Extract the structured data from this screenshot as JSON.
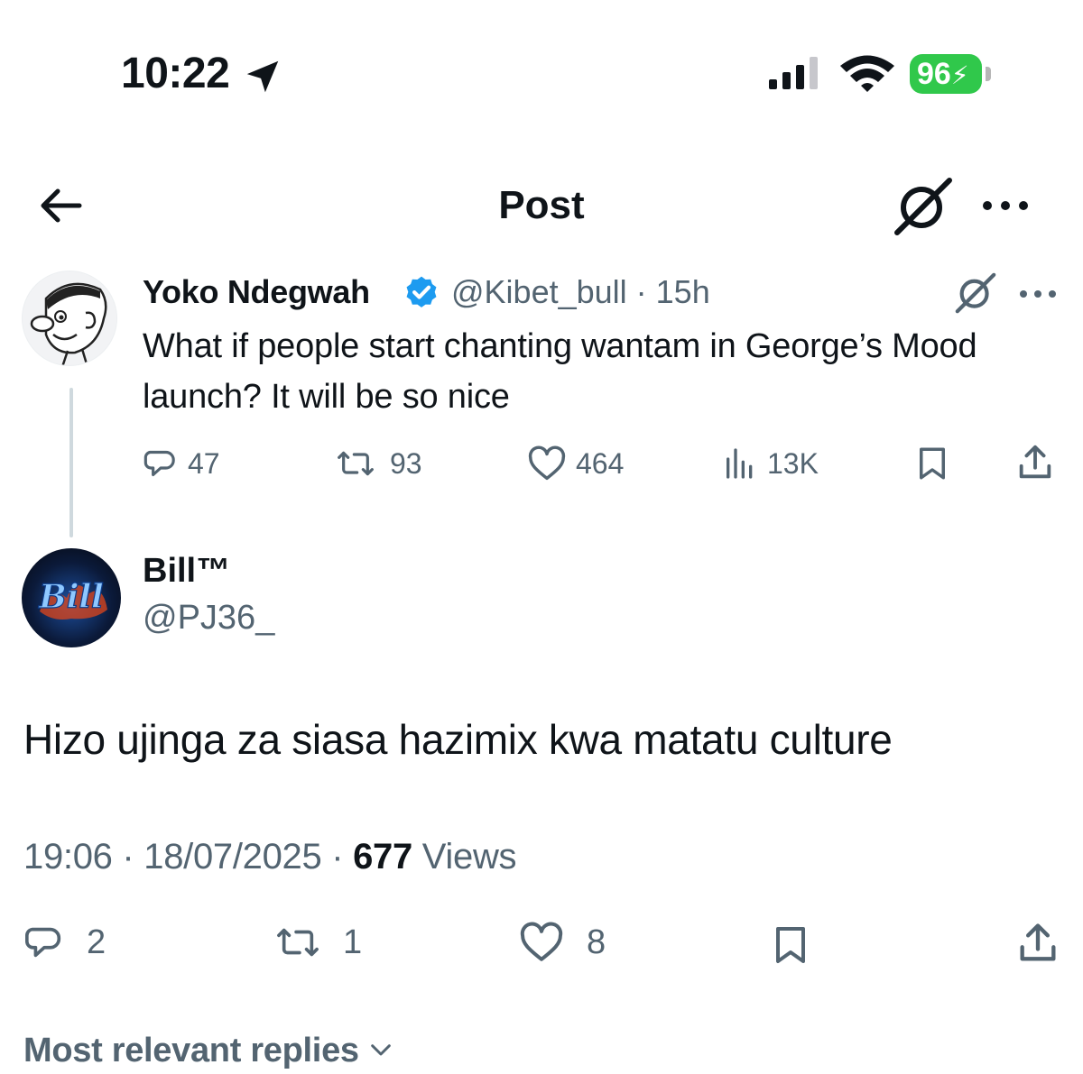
{
  "status_bar": {
    "time": "10:22",
    "battery": "96",
    "battery_color": "#30c84b",
    "icons": [
      "location-arrow-icon",
      "signal-icon",
      "wifi-icon",
      "battery-icon"
    ]
  },
  "header": {
    "title": "Post",
    "icons": [
      "back-arrow-icon",
      "grok-icon",
      "more-icon"
    ]
  },
  "quoted_post": {
    "author_name": "Yoko Ndegwah",
    "handle_time": "@Kibet_bull · 15h",
    "text": "What if people start chanting  wantam in George’s Mood launch? It will be so nice",
    "replies": "47",
    "reposts": "93",
    "likes": "464",
    "views": "13K",
    "verified_color": "#1d9bf0"
  },
  "main_post": {
    "author_name": "Bill™",
    "handle": "@PJ36_",
    "avatar_text": "Bill",
    "text": "Hizo ujinga za siasa hazimix kwa matatu culture",
    "time_date": "19:06 · 18/07/2025 · ",
    "views_count": "677",
    "views_label": " Views",
    "replies": "2",
    "reposts": "1",
    "likes": "8"
  },
  "replies_sort": {
    "label": "Most relevant replies"
  },
  "colors": {
    "text": "#0f1419",
    "secondary": "#536471",
    "thread_line": "#cfd9de"
  }
}
